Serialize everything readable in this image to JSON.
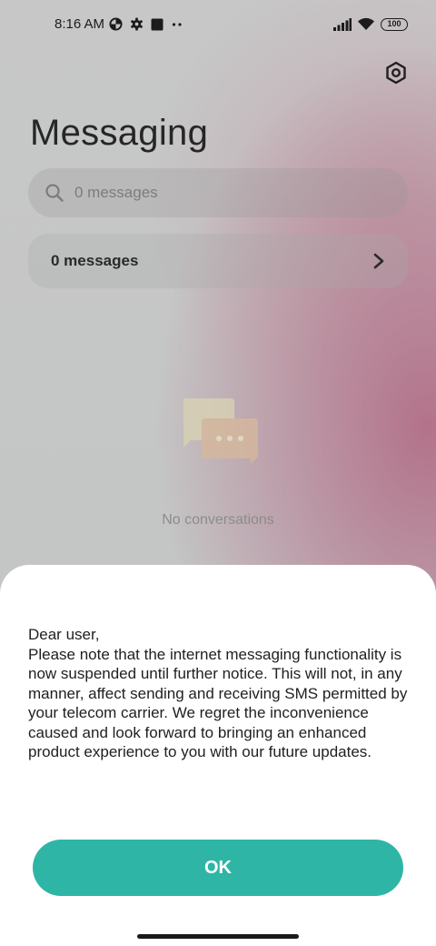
{
  "status_bar": {
    "time": "8:16 AM",
    "left_icons": [
      "data-saver-icon",
      "gear-icon",
      "square-icon",
      "more-dots-icon"
    ],
    "right_icons": [
      "signal-icon",
      "wifi-icon"
    ],
    "battery": "100"
  },
  "header": {
    "title": "Messaging",
    "settings_icon": "settings-hexagon-icon"
  },
  "search": {
    "placeholder": "0 messages",
    "icon": "search-icon"
  },
  "messages_row": {
    "label": "0 messages",
    "icon": "chevron-right-icon"
  },
  "empty_state": {
    "icon": "chat-bubbles-icon",
    "text": "No conversations"
  },
  "dialog": {
    "message": "Dear user,\nPlease note that the internet messaging functionality is now suspended until further notice. This will not, in any manner, affect sending and receiving SMS permitted by your telecom carrier. We regret the inconvenience caused and look forward to bringing an enhanced product experience to you with our future updates.",
    "ok_label": "OK"
  },
  "colors": {
    "accent": "#2eb5a6",
    "background_tint": "#b26e87"
  }
}
